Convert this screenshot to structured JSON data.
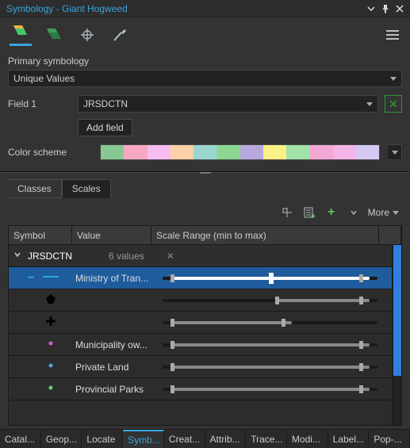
{
  "panel": {
    "title": "Symbology - Giant Hogweed"
  },
  "primary": {
    "heading": "Primary symbology",
    "renderer": "Unique Values",
    "field_label": "Field 1",
    "field_value": "JRSDCTN",
    "add_field": "Add field",
    "color_scheme_label": "Color scheme",
    "scheme_colors": [
      "#88c892",
      "#f7a8c1",
      "#f5bdf0",
      "#fdd0a6",
      "#9ad6d0",
      "#8cd693",
      "#b7a9de",
      "#f9f086",
      "#a3e2a8",
      "#f3a8d3",
      "#f3b4e7",
      "#d5c9f3"
    ]
  },
  "tabs": [
    "Classes",
    "Scales"
  ],
  "active_tab": 1,
  "more_label": "More",
  "columns": {
    "symbol": "Symbol",
    "value": "Value",
    "range": "Scale Range (min to max)"
  },
  "group": {
    "field": "JRSDCTN",
    "count_text": "6 values"
  },
  "rows": [
    {
      "symbol_kind": "line",
      "symbol_color": "#2aa7d4",
      "value": "Ministry of Tran...",
      "selected": true,
      "range_start_pct": 4,
      "range_end_pct": 96
    },
    {
      "symbol_kind": "poly",
      "symbol_color": "#000000",
      "value": "",
      "selected": false,
      "range_start_pct": 55,
      "range_end_pct": 96
    },
    {
      "symbol_kind": "plus",
      "symbol_color": "#000000",
      "value": "",
      "selected": false,
      "range_start_pct": 4,
      "range_end_pct": 58
    },
    {
      "symbol_kind": "dot",
      "symbol_color": "#d65bd6",
      "value": "Municipality ow...",
      "selected": false,
      "range_start_pct": 4,
      "range_end_pct": 96
    },
    {
      "symbol_kind": "dot",
      "symbol_color": "#4aa6e8",
      "value": "Private Land",
      "selected": false,
      "range_start_pct": 4,
      "range_end_pct": 96
    },
    {
      "symbol_kind": "dot",
      "symbol_color": "#58d67f",
      "value": "Provincial Parks",
      "selected": false,
      "range_start_pct": 4,
      "range_end_pct": 96
    }
  ],
  "footer_tabs": [
    "Catal...",
    "Geop...",
    "Locate",
    "Symb...",
    "Creat...",
    "Attrib...",
    "Trace...",
    "Modi...",
    "Label...",
    "Pop-..."
  ],
  "footer_active": 3
}
